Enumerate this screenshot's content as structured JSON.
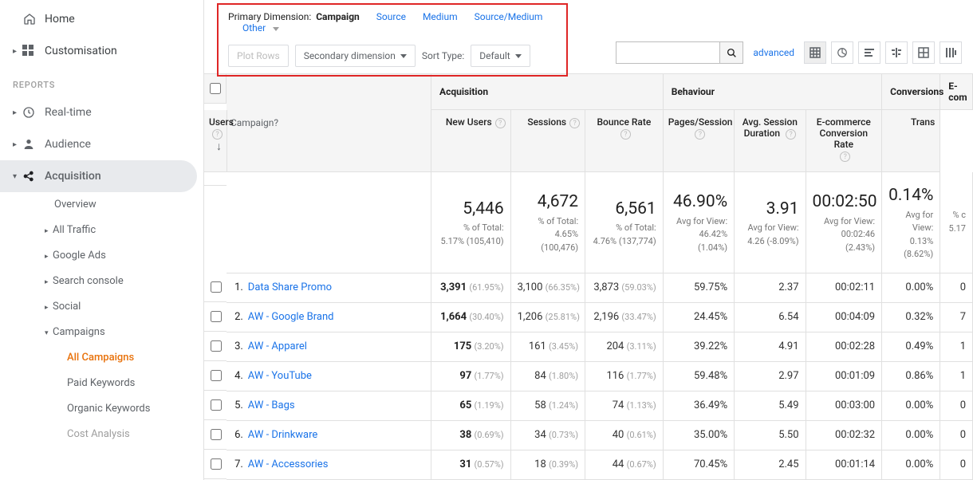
{
  "sidebar": {
    "home": "Home",
    "customisation": "Customisation",
    "reports_hdr": "REPORTS",
    "realtime": "Real-time",
    "audience": "Audience",
    "acquisition": "Acquisition",
    "subs": [
      "Overview",
      "All Traffic",
      "Google Ads",
      "Search console",
      "Social"
    ],
    "campaigns": "Campaigns",
    "camp_items": [
      "All Campaigns",
      "Paid Keywords",
      "Organic Keywords",
      "Cost Analysis"
    ]
  },
  "dimbar": {
    "label": "Primary Dimension:",
    "active": "Campaign",
    "links": [
      "Source",
      "Medium",
      "Source/Medium",
      "Other"
    ],
    "plot": "Plot Rows",
    "secondary": "Secondary dimension",
    "sort_lbl": "Sort Type:",
    "sort_val": "Default"
  },
  "toolbar": {
    "advanced": "advanced"
  },
  "table": {
    "camp_hdr": "Campaign",
    "groups": {
      "acq": "Acquisition",
      "beh": "Behaviour",
      "conv": "Conversions",
      "ecom": "E-com"
    },
    "cols": {
      "users": "Users",
      "newusers": "New Users",
      "sessions": "Sessions",
      "bounce": "Bounce Rate",
      "pps": "Pages/Session",
      "dur": "Avg. Session Duration",
      "ecr": "E-commerce Conversion Rate",
      "trans": "Trans"
    },
    "totals": {
      "users": {
        "v": "5,446",
        "s1": "% of Total:",
        "s2": "5.17% (105,410)"
      },
      "newusers": {
        "v": "4,672",
        "s1": "% of Total:",
        "s2": "4.65% (100,476)"
      },
      "sessions": {
        "v": "6,561",
        "s1": "% of Total:",
        "s2": "4.76% (137,774)"
      },
      "bounce": {
        "v": "46.90%",
        "s1": "Avg for View:",
        "s2": "46.42%",
        "s3": "(1.04%)"
      },
      "pps": {
        "v": "3.91",
        "s1": "Avg for View:",
        "s2": "4.26 (-8.09%)"
      },
      "dur": {
        "v": "00:02:50",
        "s1": "Avg for View:",
        "s2": "00:02:46",
        "s3": "(2.43%)"
      },
      "ecr": {
        "v": "0.14%",
        "s1": "Avg for",
        "s2": "View:",
        "s3": "0.13%",
        "s4": "(8.62%)"
      },
      "trans": {
        "v": "",
        "s1": "% c",
        "s2": "5.17"
      }
    },
    "rows": [
      {
        "n": "1.",
        "name": "Data Share Promo",
        "users": "3,391",
        "users_p": "(61.95%)",
        "nu": "3,100",
        "nu_p": "(66.35%)",
        "s": "3,873",
        "s_p": "(59.03%)",
        "b": "59.75%",
        "pps": "2.37",
        "d": "00:02:11",
        "ecr": "0.00%",
        "t": "0"
      },
      {
        "n": "2.",
        "name": "AW - Google Brand",
        "users": "1,664",
        "users_p": "(30.40%)",
        "nu": "1,206",
        "nu_p": "(25.81%)",
        "s": "2,196",
        "s_p": "(33.47%)",
        "b": "24.45%",
        "pps": "6.54",
        "d": "00:04:09",
        "ecr": "0.32%",
        "t": "7"
      },
      {
        "n": "3.",
        "name": "AW - Apparel",
        "users": "175",
        "users_p": "(3.20%)",
        "nu": "161",
        "nu_p": "(3.45%)",
        "s": "204",
        "s_p": "(3.11%)",
        "b": "39.22%",
        "pps": "4.91",
        "d": "00:02:28",
        "ecr": "0.49%",
        "t": "1"
      },
      {
        "n": "4.",
        "name": "AW - YouTube",
        "users": "97",
        "users_p": "(1.77%)",
        "nu": "84",
        "nu_p": "(1.80%)",
        "s": "116",
        "s_p": "(1.77%)",
        "b": "59.48%",
        "pps": "2.97",
        "d": "00:01:09",
        "ecr": "0.86%",
        "t": "1"
      },
      {
        "n": "5.",
        "name": "AW - Bags",
        "users": "65",
        "users_p": "(1.19%)",
        "nu": "58",
        "nu_p": "(1.24%)",
        "s": "74",
        "s_p": "(1.13%)",
        "b": "36.49%",
        "pps": "5.49",
        "d": "00:03:00",
        "ecr": "0.00%",
        "t": "0"
      },
      {
        "n": "6.",
        "name": "AW - Drinkware",
        "users": "38",
        "users_p": "(0.69%)",
        "nu": "34",
        "nu_p": "(0.73%)",
        "s": "40",
        "s_p": "(0.61%)",
        "b": "35.00%",
        "pps": "5.50",
        "d": "00:02:32",
        "ecr": "0.00%",
        "t": "0"
      },
      {
        "n": "7.",
        "name": "AW - Accessories",
        "users": "31",
        "users_p": "(0.57%)",
        "nu": "18",
        "nu_p": "(0.39%)",
        "s": "44",
        "s_p": "(0.67%)",
        "b": "70.45%",
        "pps": "2.45",
        "d": "00:01:14",
        "ecr": "0.00%",
        "t": "0"
      }
    ]
  }
}
